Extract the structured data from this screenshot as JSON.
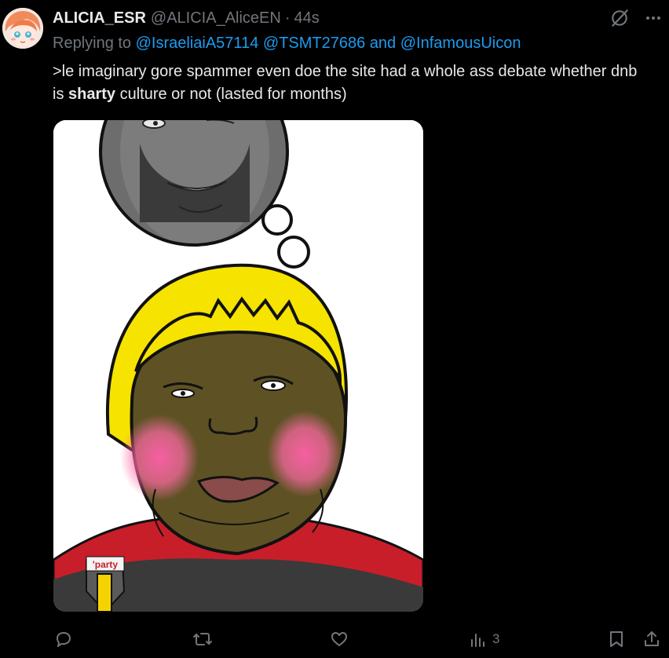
{
  "tweet": {
    "display_name": "ALICIA_ESR",
    "handle": "@ALICIA_AliceEN",
    "separator": "·",
    "time": "44s",
    "replying_prefix": "Replying to",
    "mention_1": "@IsraeliaiA57114",
    "mention_2": "@TSMT27686",
    "mention_joiner": "and",
    "mention_3": "@InfamousUicon",
    "text_part1": ">le imaginary gore spammer even doe the site had a whole ass debate whether dnb is ",
    "text_bold": "sharty",
    "text_part2": " culture or not (lasted for months)"
  },
  "media": {
    "shirt_badge_text": "'party"
  },
  "actions": {
    "views_count": "3"
  },
  "icons": [
    "avatar",
    "grok-icon",
    "more-icon",
    "reply-icon",
    "retweet-icon",
    "like-icon",
    "views-icon",
    "bookmark-icon",
    "share-icon"
  ],
  "colors": {
    "background": "#000000",
    "text": "#e7e9ea",
    "secondary": "#71767b",
    "link": "#1d9bf0"
  }
}
